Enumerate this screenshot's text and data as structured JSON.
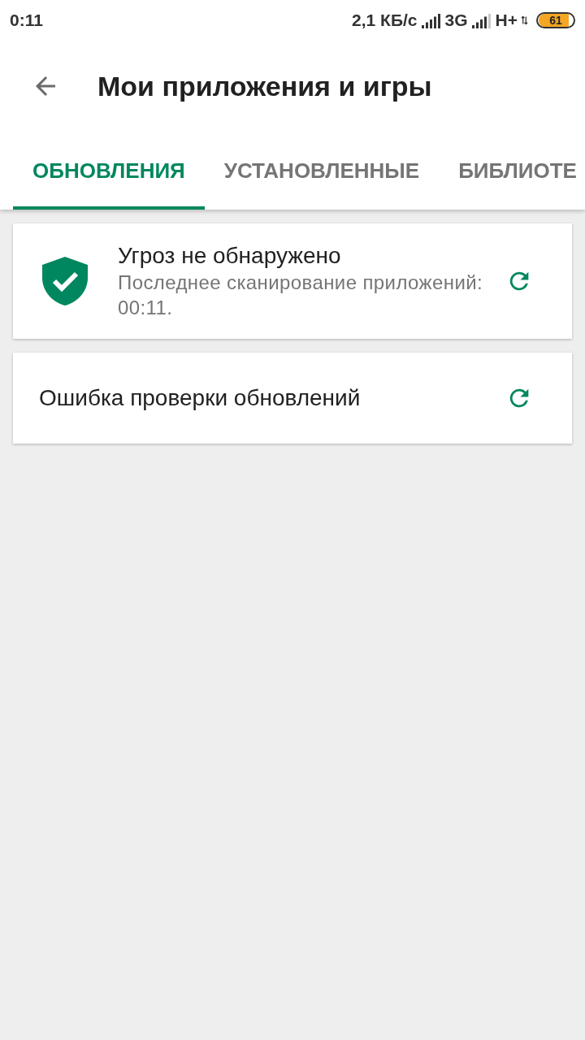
{
  "status_bar": {
    "time": "0:11",
    "network_speed": "2,1 КБ/с",
    "network_type": "3G",
    "network_type_2": "H+",
    "battery": "61"
  },
  "app_bar": {
    "title": "Мои приложения и игры"
  },
  "tabs": [
    {
      "label": "ОБНОВЛЕНИЯ",
      "selected": true
    },
    {
      "label": "УСТАНОВЛЕННЫЕ",
      "selected": false
    },
    {
      "label": "БИБЛИОТЕ",
      "selected": false
    }
  ],
  "cards": [
    {
      "kind": "security",
      "title": "Угроз не обнаружено",
      "subtitle": "Последнее сканирование приложений: 00:11."
    },
    {
      "kind": "message",
      "title": "Ошибка проверки обновлений"
    }
  ]
}
